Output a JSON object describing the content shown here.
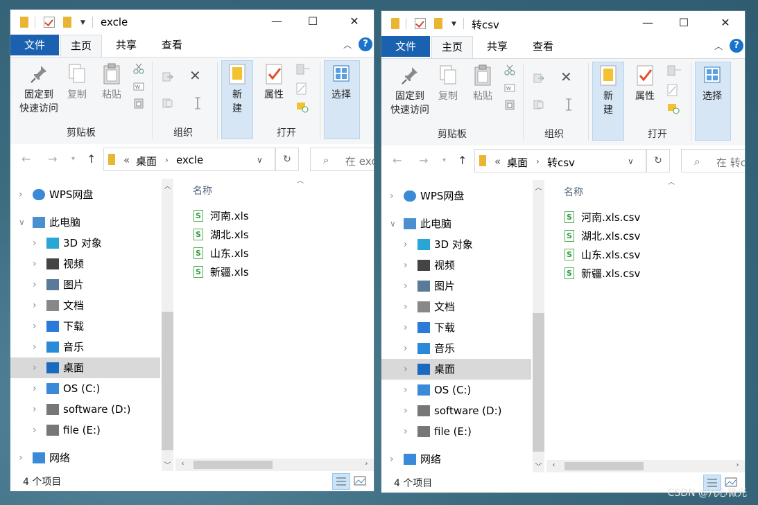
{
  "windows": [
    {
      "title": "excle",
      "ribbon_tabs": {
        "file": "文件",
        "home": "主页",
        "share": "共享",
        "view": "查看"
      },
      "help": "?",
      "clipboard": {
        "pin": "固定到",
        "pin2": "快速访问",
        "copy": "复制",
        "paste": "粘贴",
        "group": "剪贴板"
      },
      "organize": {
        "group": "组织"
      },
      "new": {
        "label": "新",
        "label2": "建"
      },
      "open": {
        "props": "属性",
        "group": "打开"
      },
      "select": {
        "label": "选择"
      },
      "address": {
        "sep": "«",
        "crumb1": "桌面",
        "crumb2": "excle"
      },
      "search_placeholder": "在 exc",
      "nav": [
        "WPS网盘",
        "此电脑",
        "3D 对象",
        "视频",
        "图片",
        "文档",
        "下载",
        "音乐",
        "桌面",
        "OS (C:)",
        "software (D:)",
        "file (E:)",
        "网络"
      ],
      "column_name": "名称",
      "files": [
        "河南.xls",
        "湖北.xls",
        "山东.xls",
        "新疆.xls"
      ],
      "status": "4 个项目"
    },
    {
      "title": "转csv",
      "ribbon_tabs": {
        "file": "文件",
        "home": "主页",
        "share": "共享",
        "view": "查看"
      },
      "help": "?",
      "clipboard": {
        "pin": "固定到",
        "pin2": "快速访问",
        "copy": "复制",
        "paste": "粘贴",
        "group": "剪贴板"
      },
      "organize": {
        "group": "组织"
      },
      "new": {
        "label": "新",
        "label2": "建"
      },
      "open": {
        "props": "属性",
        "group": "打开"
      },
      "select": {
        "label": "选择"
      },
      "address": {
        "sep": "«",
        "crumb1": "桌面",
        "crumb2": "转csv"
      },
      "search_placeholder": "在 转c",
      "nav": [
        "WPS网盘",
        "此电脑",
        "3D 对象",
        "视频",
        "图片",
        "文档",
        "下载",
        "音乐",
        "桌面",
        "OS (C:)",
        "software (D:)",
        "file (E:)",
        "网络"
      ],
      "column_name": "名称",
      "files": [
        "河南.xls.csv",
        "湖北.xls.csv",
        "山东.xls.csv",
        "新疆.xls.csv"
      ],
      "status": "4 个项目"
    }
  ],
  "watermark": "CSDN @凡心微光",
  "colors": {
    "file_tab": "#1a62b0",
    "selected_nav": "#d9d9d9",
    "accent": "#1a73c8"
  }
}
